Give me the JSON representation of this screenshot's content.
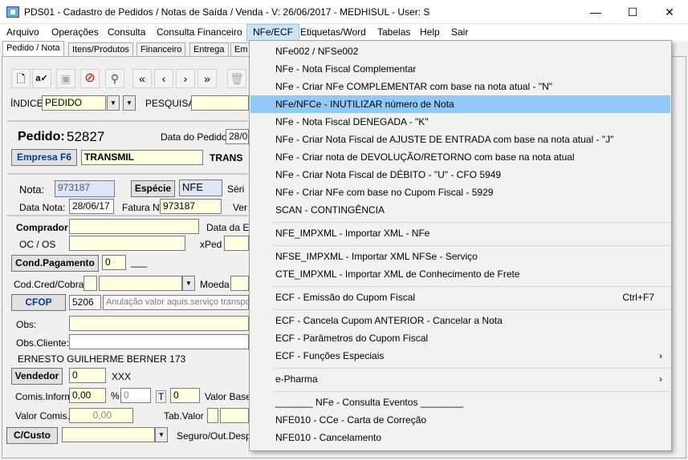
{
  "window": {
    "title": "PDS01 - Cadastro de Pedidos / Notas de Saída / Venda - V: 26/06/2017 - MEDHISUL - User: S",
    "minimize": "—",
    "maximize": "☐",
    "close": "✕"
  },
  "menubar": [
    "Arquivo",
    "Operações",
    "Consulta",
    "Consulta Financeiro",
    "NFe/ECF",
    "Etiquetas/Word",
    "Tabelas",
    "Help",
    "Sair"
  ],
  "tabs": [
    "Pedido / Nota",
    "Itens/Produtos",
    "Financeiro",
    "Entrega",
    "Em"
  ],
  "toolbar_icons": [
    "new-document-icon",
    "spell-check-icon",
    "save-icon",
    "cancel-icon",
    "search-icon",
    "first-record-icon",
    "previous-record-icon",
    "next-record-icon",
    "last-record-icon",
    "delete-icon"
  ],
  "index": {
    "label": "ÍNDICE",
    "value": "PEDIDO",
    "search_label": "PESQUISA"
  },
  "pedido": {
    "label": "Pedido:",
    "number": "52827",
    "data_label": "Data do Pedido:",
    "data_value": "28/0"
  },
  "empresa": {
    "button": "Empresa F6",
    "value": "TRANSMIL",
    "trailing": "TRANS"
  },
  "nota": {
    "label": "Nota:",
    "value": "973187",
    "especie_button": "Espécie",
    "especie_value": "NFE",
    "serie_label": "Séri",
    "data_label": "Data Nota:",
    "data_value": "28/06/17",
    "fatura_label": "Fatura Nº",
    "fatura_value": "973187",
    "ver_label": "Ver"
  },
  "comprador": {
    "label": "Comprador",
    "data_label": "Data da En",
    "oc_label": "OC / OS",
    "xped_label": "xPed"
  },
  "cond_pagamento": {
    "button": "Cond.Pagamento",
    "value": "0",
    "trailing": "___"
  },
  "cod_cred": {
    "label": "Cod.Cred/Cobran",
    "moeda_label": "Moeda"
  },
  "cfop": {
    "button": "CFOP",
    "code": "5206",
    "description": "Anulação valor aquis.serviço transpo"
  },
  "obs": {
    "label": "Obs:",
    "cliente_label": "Obs.Cliente:",
    "client_name": "ERNESTO GUILHERME BERNER  173"
  },
  "vendedor": {
    "button": "Vendedor",
    "value": "0",
    "trailing": "XXX"
  },
  "comis": {
    "label": "Comis.Inform.",
    "value": "0,00",
    "pct": "%",
    "pct_value": "0",
    "t": "T",
    "t_value": "0",
    "valor_base_label": "Valor Base"
  },
  "valor_comis": {
    "label": "Valor Comis.",
    "value": "0,00",
    "tab_valor_label": "Tab.Valor"
  },
  "custo": {
    "button": "C/Custo",
    "seguro_label": "Seguro/Out.Desp:"
  },
  "dropdown": [
    {
      "label": "NFe002 / NFSe002"
    },
    {
      "label": "NFe - Nota Fiscal Complementar"
    },
    {
      "label": "NFe - Criar NFe COMPLEMENTAR com base na nota atual - \"N\""
    },
    {
      "label": "NFe/NFCe - INUTILIZAR número de Nota",
      "highlighted": true
    },
    {
      "label": "NFe - Nota Fiscal DENEGADA - \"K\""
    },
    {
      "label": "NFe - Criar Nota Fiscal de AJUSTE DE ENTRADA com base na nota atual - \"J\""
    },
    {
      "label": "NFe - Criar nota de DEVOLUÇÃO/RETORNO com base na nota atual"
    },
    {
      "label": "NFe - Criar Nota Fiscal de DÉBITO - \"U\" - CFO 5949"
    },
    {
      "label": "NFe - Criar NFe com base no Cupom Fiscal - 5929"
    },
    {
      "label": "SCAN - CONTINGÊNCIA"
    },
    {
      "separator": true
    },
    {
      "label": "NFE_IMPXML - Importar XML - NFe"
    },
    {
      "separator": true
    },
    {
      "label": "NFSE_IMPXML - Importar XML NFSe - Serviço"
    },
    {
      "label": "CTE_IMPXML - Importar XML de Conhecimento de Frete"
    },
    {
      "separator": true
    },
    {
      "label": "ECF - Emissão do Cupom Fiscal",
      "shortcut": "Ctrl+F7"
    },
    {
      "separator": true
    },
    {
      "label": "ECF - Cancela Cupom ANTERIOR - Cancelar a Nota"
    },
    {
      "label": "ECF - Parâmetros do Cupom Fiscal"
    },
    {
      "label": "ECF - Funções Especiais",
      "submenu": true
    },
    {
      "separator": true
    },
    {
      "label": "e-Pharma",
      "submenu": true
    },
    {
      "separator": true
    },
    {
      "label": "_______ NFe - Consulta Eventos ________"
    },
    {
      "label": "NFE010 - CCe - Carta de Correção"
    },
    {
      "label": "NFE010 - Cancelamento"
    }
  ]
}
